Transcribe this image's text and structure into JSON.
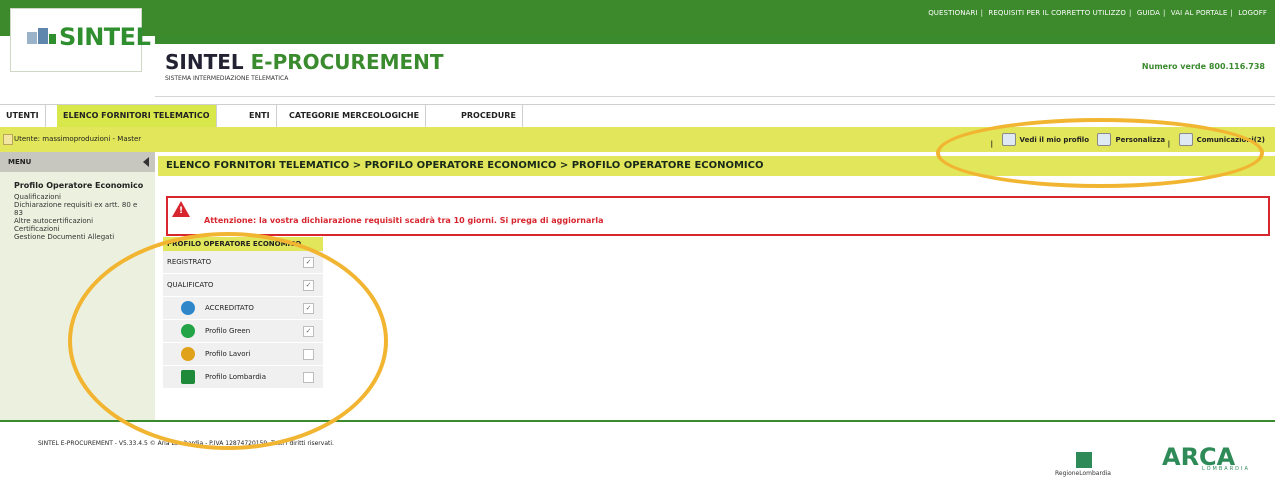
{
  "topbar": {
    "links": [
      "QUESTIONARI",
      "REQUISITI PER IL CORRETTO UTILIZZO",
      "GUIDA",
      "VAI AL PORTALE",
      "LOGOFF"
    ]
  },
  "logo": {
    "text": "SINTEL",
    "sub": ""
  },
  "brand": {
    "title_main": "SINTEL ",
    "title_accent": "E-PROCUREMENT",
    "subtitle": "SISTEMA INTERMEDIAZIONE TELEMATICA",
    "numero_verde": "Numero verde 800.116.738"
  },
  "nav": {
    "tabs": [
      {
        "label": "UTENTI",
        "active": false
      },
      {
        "label": "ELENCO FORNITORI TELEMATICO",
        "active": true
      },
      {
        "label": "ENTI",
        "active": false
      },
      {
        "label": "CATEGORIE MERCEOLOGICHE",
        "active": false
      },
      {
        "label": "PROCEDURE",
        "active": false
      }
    ]
  },
  "userbar": {
    "user": "Utente: massimoproduzioni - Master",
    "profile_link": "Vedi il mio profilo",
    "personalize": "Personalizza",
    "communications": "Comunicazioni(2)"
  },
  "sidebar": {
    "menu_title": "MENU",
    "section_title": "Profilo Operatore Economico",
    "links": [
      "Qualificazioni",
      "Dichiarazione requisiti ex artt. 80 e 83",
      "Altre autocertificazioni",
      "Certificazioni",
      "Gestione Documenti Allegati"
    ]
  },
  "breadcrumb": "ELENCO FORNITORI TELEMATICO  > PROFILO OPERATORE ECONOMICO  > PROFILO OPERATORE ECONOMICO",
  "warning": {
    "text": "Attenzione: la vostra dichiarazione requisiti scadrà tra 10 giorni. Si prega di aggiornarla"
  },
  "profile_table": {
    "header": "PROFILO OPERATORE ECONOMICO",
    "rows": [
      {
        "label": "REGISTRATO",
        "checked": true
      },
      {
        "label": "QUALIFICATO",
        "checked": true
      },
      {
        "label": "ACCREDITATO",
        "checked": true,
        "icon": "accreditato-icon",
        "color": "#2f86c9"
      },
      {
        "label": "Profilo Green",
        "checked": true,
        "icon": "green-icon",
        "color": "#22a447"
      },
      {
        "label": "Profilo Lavori",
        "checked": false,
        "icon": "lavori-icon",
        "color": "#e0a21a"
      },
      {
        "label": "Profilo Lombardia",
        "checked": false,
        "icon": "lombardia-icon",
        "color": "#1f8a3a"
      }
    ]
  },
  "footer": {
    "copyright": "SINTEL E-PROCUREMENT - V5.33.4.5 © Aria Lombardia - P.IVA 12874720159. Tutti i diritti riservati.",
    "regione": "RegioneLombardia",
    "arca": "ARCA",
    "arca_sub": "LOMBARDIA"
  },
  "colors": {
    "brand_green": "#3a8a2e",
    "highlight_yellow": "#e1e65a",
    "warning_red": "#d8262f",
    "annotation_orange": "#f2b531"
  }
}
